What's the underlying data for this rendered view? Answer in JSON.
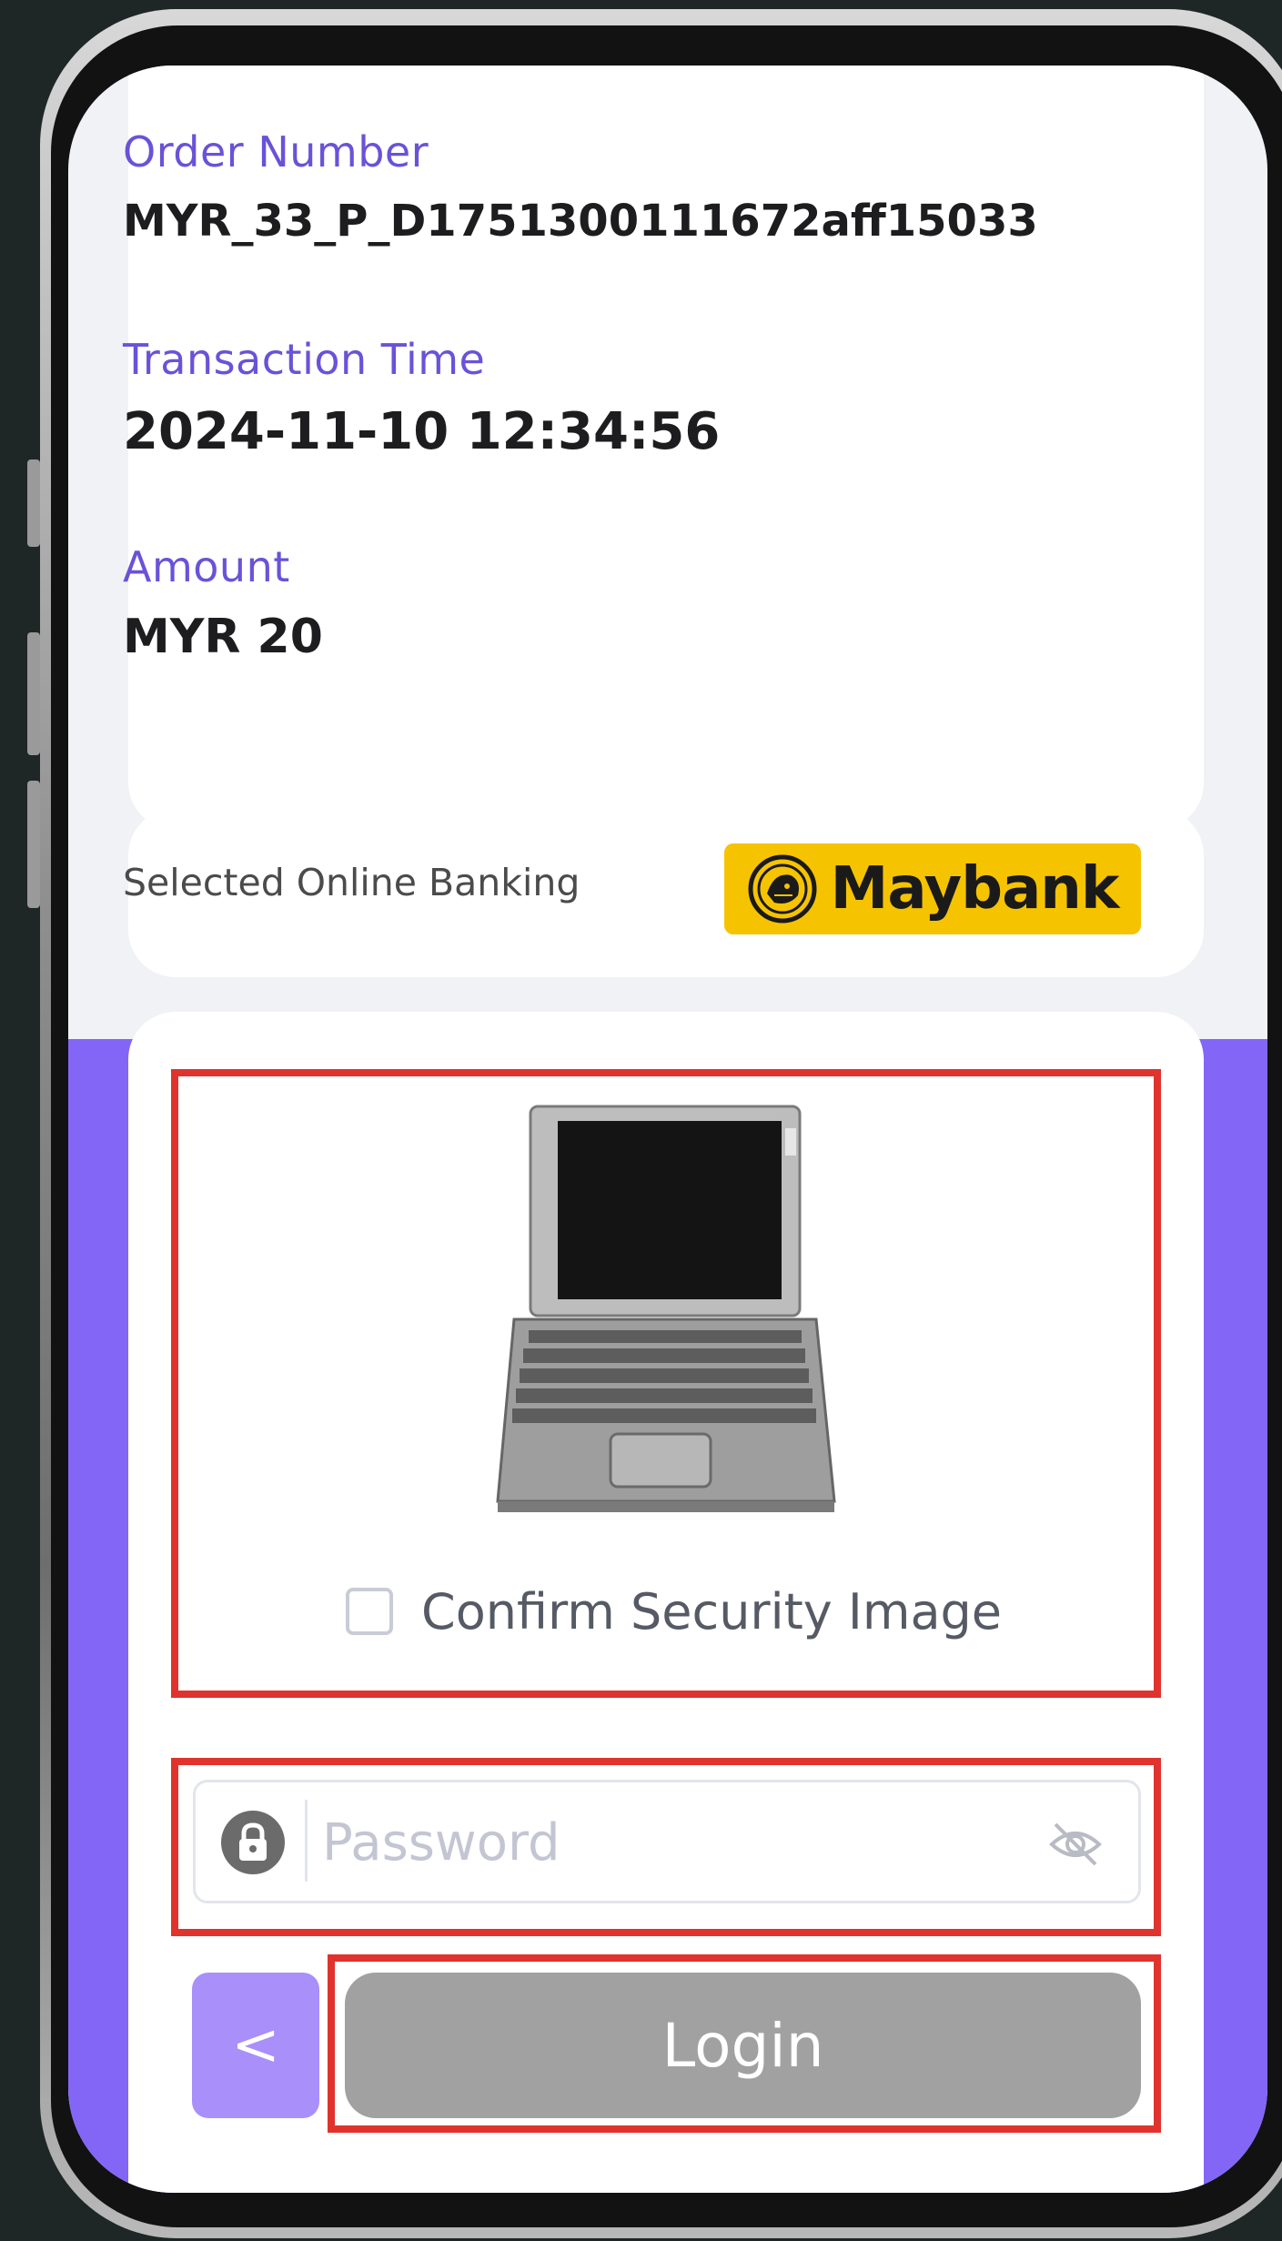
{
  "order": {
    "number_label": "Order Number",
    "number_value": "MYR_33_P_D1751300111672aff15033",
    "time_label": "Transaction Time",
    "time_value": "2024-11-10 12:34:56",
    "amount_label": "Amount",
    "amount_value": "MYR 20"
  },
  "bank": {
    "selected_label": "Selected Online Banking",
    "name": "Maybank",
    "badge_color": "#f6c300"
  },
  "security": {
    "image_icon": "laptop-icon",
    "confirm_label": "Confirm Security Image",
    "confirmed": false
  },
  "password": {
    "placeholder": "Password",
    "value": "",
    "icon": "lock-icon",
    "toggle_icon": "eye-off-icon"
  },
  "actions": {
    "back_symbol": "<",
    "login_label": "Login"
  },
  "colors": {
    "accent": "#8466f7",
    "label": "#6a52d8",
    "highlight": "#e0332e",
    "login_disabled": "#a1a1a1"
  }
}
